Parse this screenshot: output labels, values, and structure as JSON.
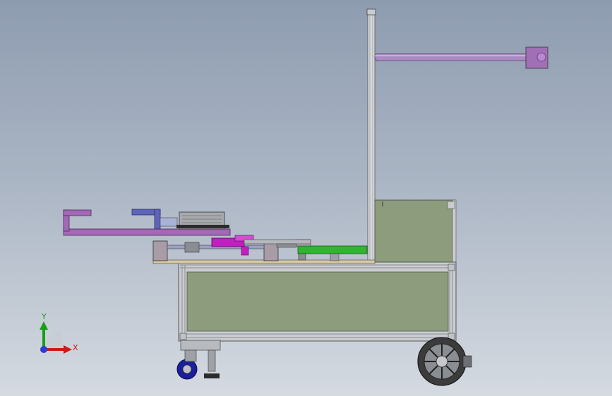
{
  "triad": {
    "x_label": "X",
    "y_label": "Y",
    "x_color": "#d01818",
    "y_color": "#1a9e1a",
    "z_color": "#2b3bd6"
  },
  "colors": {
    "frame": "#c9ccd0",
    "panel": "#8c9c7c",
    "arm": "#a567b8",
    "motor": "#8a8e92",
    "green_plate": "#2fb52f",
    "magenta": "#c020c0",
    "blue_clamp": "#5f64b7",
    "tire": "#3c3c3c",
    "caster": "#1b1f9a"
  }
}
